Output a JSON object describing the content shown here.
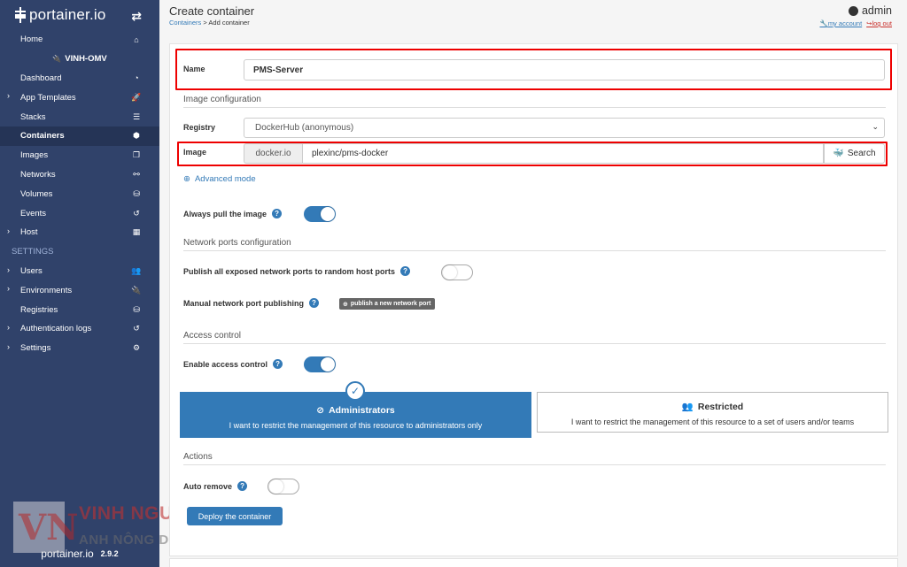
{
  "sidebar": {
    "brand": "portainer.io",
    "toggle_icon": "⇄",
    "items": [
      {
        "label": "Home",
        "icon": "⌂",
        "chevron": ""
      },
      {
        "label": "VINH-OMV",
        "icon": "",
        "chevron": "",
        "env_icon": "🔌"
      },
      {
        "label": "Dashboard",
        "icon": "◔",
        "chevron": ""
      },
      {
        "label": "App Templates",
        "icon": "🚀",
        "chevron": "›"
      },
      {
        "label": "Stacks",
        "icon": "☰",
        "chevron": ""
      },
      {
        "label": "Containers",
        "icon": "⬢",
        "chevron": ""
      },
      {
        "label": "Images",
        "icon": "❐",
        "chevron": ""
      },
      {
        "label": "Networks",
        "icon": "⚯",
        "chevron": ""
      },
      {
        "label": "Volumes",
        "icon": "⛁",
        "chevron": ""
      },
      {
        "label": "Events",
        "icon": "↺",
        "chevron": ""
      },
      {
        "label": "Host",
        "icon": "▦",
        "chevron": "›"
      },
      {
        "label": "SETTINGS",
        "icon": "",
        "chevron": ""
      },
      {
        "label": "Users",
        "icon": "👥",
        "chevron": "›"
      },
      {
        "label": "Environments",
        "icon": "🔌",
        "chevron": "›"
      },
      {
        "label": "Registries",
        "icon": "⛁",
        "chevron": ""
      },
      {
        "label": "Authentication logs",
        "icon": "↺",
        "chevron": "›"
      },
      {
        "label": "Settings",
        "icon": "⚙",
        "chevron": "›"
      }
    ],
    "footer_brand": "portainer.io",
    "footer_version": "2.9.2"
  },
  "watermark": {
    "mark": "VN",
    "line1": "VINH NGUYỄN",
    "line2": "ANH NÔNG DÂN IT"
  },
  "header": {
    "title": "Create container",
    "crumb_link": "Containers",
    "crumb_rest": " > Add container",
    "user": "admin",
    "my_account": "my account",
    "log_out": "log out"
  },
  "form": {
    "name_label": "Name",
    "name_value": "PMS-Server",
    "image_config_title": "Image configuration",
    "registry_label": "Registry",
    "registry_value": "DockerHub (anonymous)",
    "image_label": "Image",
    "image_prefix": "docker.io",
    "image_value": "plexinc/pms-docker",
    "search_label": "Search",
    "advanced_mode": "Advanced mode",
    "always_pull_label": "Always pull the image",
    "always_pull_on": true,
    "network_ports_title": "Network ports configuration",
    "publish_all_label": "Publish all exposed network ports to random host ports",
    "publish_all_on": false,
    "manual_publish_label": "Manual network port publishing",
    "publish_new_port": "publish a new network port",
    "access_control_title": "Access control",
    "enable_access_label": "Enable access control",
    "enable_access_on": true,
    "admin_title": "Administrators",
    "admin_desc": "I want to restrict the management of this resource to administrators only",
    "restricted_title": "Restricted",
    "restricted_desc": "I want to restrict the management of this resource to a set of users and/or teams",
    "actions_title": "Actions",
    "auto_remove_label": "Auto remove",
    "auto_remove_on": false,
    "deploy_label": "Deploy the container"
  },
  "colors": {
    "sidebar_bg": "#30426a",
    "primary": "#337ab7",
    "highlight_red": "#e00000"
  }
}
